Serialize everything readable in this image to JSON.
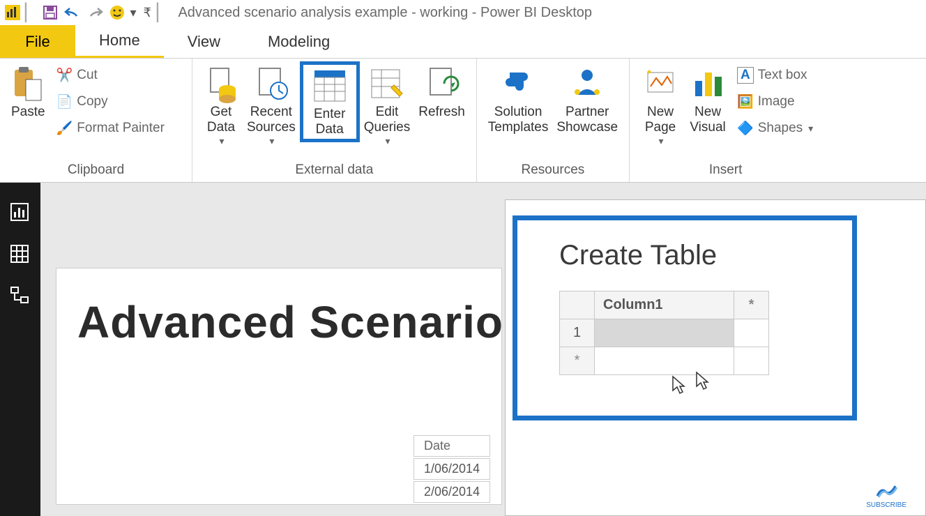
{
  "title": "Advanced scenario analysis example - working - Power BI Desktop",
  "menus": {
    "file": "File",
    "home": "Home",
    "view": "View",
    "modeling": "Modeling"
  },
  "clipboard": {
    "paste": "Paste",
    "cut": "Cut",
    "copy": "Copy",
    "fmt": "Format Painter",
    "group": "Clipboard"
  },
  "extdata": {
    "getdata": "Get\nData",
    "recent": "Recent\nSources",
    "enter": "Enter\nData",
    "edit": "Edit\nQueries",
    "refresh": "Refresh",
    "group": "External data"
  },
  "resources": {
    "sol": "Solution\nTemplates",
    "partner": "Partner\nShowcase",
    "group": "Resources"
  },
  "insert": {
    "page": "New\nPage",
    "visual": "New\nVisual",
    "textbox": "Text box",
    "image": "Image",
    "shapes": "Shapes",
    "group": "Insert"
  },
  "canvas": {
    "heading": "Advanced Scenario",
    "dates_header": "Date",
    "dates": [
      "1/06/2014",
      "2/06/2014"
    ]
  },
  "dialog": {
    "title": "Create Table",
    "col": "Column1",
    "add": "*",
    "row1": "1",
    "rowadd": "*"
  },
  "subscribe": "SUBSCRIBE"
}
